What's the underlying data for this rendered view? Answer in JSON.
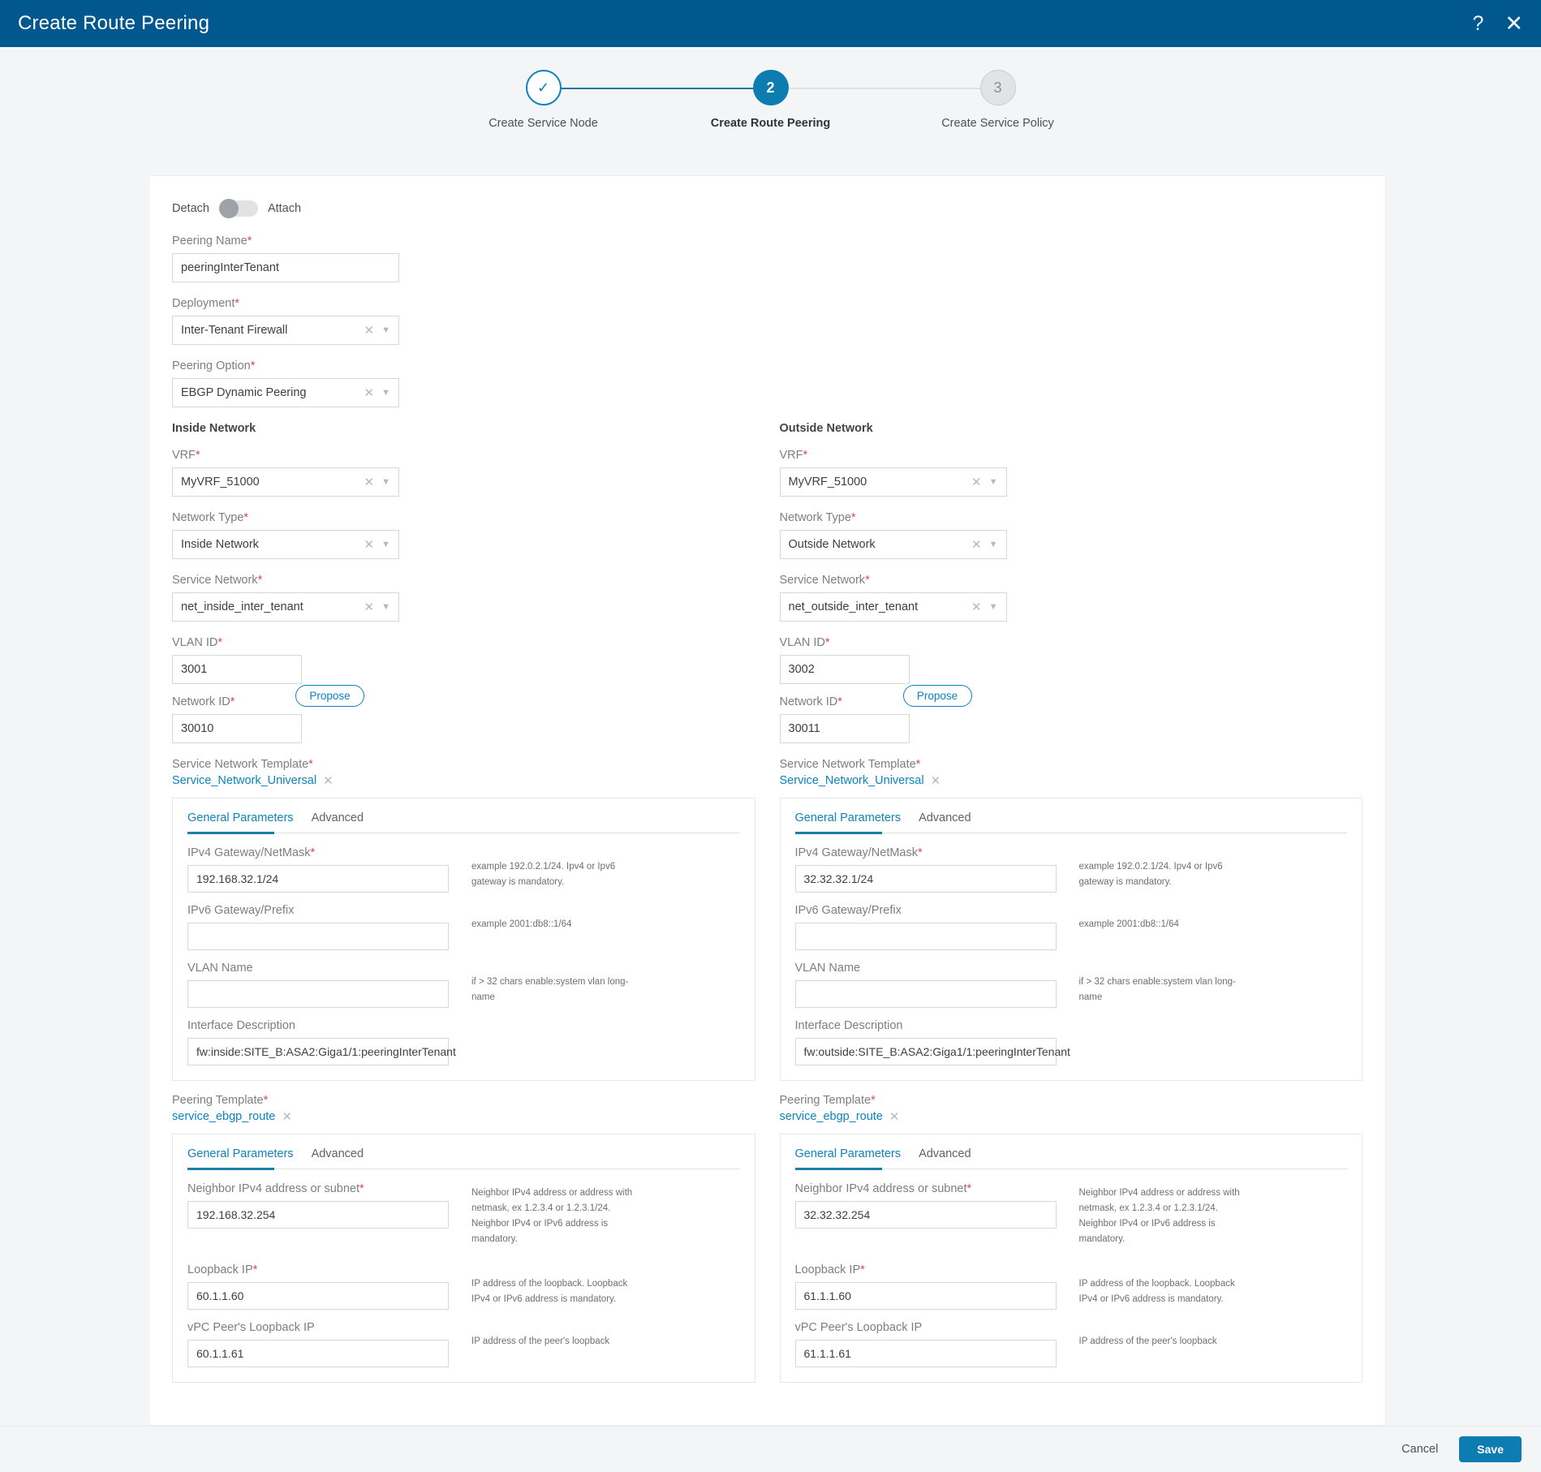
{
  "header": {
    "title": "Create Route Peering",
    "help_icon": "question-mark-icon",
    "close_icon": "close-icon"
  },
  "stepper": {
    "steps": [
      {
        "number": "1",
        "glyph": "✓",
        "label": "Create Service Node",
        "state": "done"
      },
      {
        "number": "2",
        "glyph": "2",
        "label": "Create Route Peering",
        "state": "active"
      },
      {
        "number": "3",
        "glyph": "3",
        "label": "Create Service Policy",
        "state": "todo"
      }
    ]
  },
  "toggle": {
    "left_label": "Detach",
    "right_label": "Attach",
    "state": "detach"
  },
  "form": {
    "peering_name": {
      "label": "Peering Name",
      "required": true,
      "value": "peeringInterTenant"
    },
    "deployment": {
      "label": "Deployment",
      "required": true,
      "value": "Inter-Tenant Firewall"
    },
    "peering_option": {
      "label": "Peering Option",
      "required": true,
      "value": "EBGP Dynamic Peering"
    }
  },
  "inside": {
    "heading": "Inside Network",
    "vrf": {
      "label": "VRF",
      "value": "MyVRF_51000"
    },
    "network_type": {
      "label": "Network Type",
      "value": "Inside Network"
    },
    "service_network": {
      "label": "Service Network",
      "value": "net_inside_inter_tenant"
    },
    "vlan_id": {
      "label": "VLAN ID",
      "value": "3001"
    },
    "network_id": {
      "label": "Network ID",
      "value": "30010"
    },
    "propose_label": "Propose",
    "service_network_template": {
      "label": "Service Network Template",
      "value": "Service_Network_Universal"
    },
    "net_tabs": {
      "general": "General Parameters",
      "advanced": "Advanced"
    },
    "net_params": {
      "ipv4_gateway": {
        "label": "IPv4 Gateway/NetMask",
        "required": true,
        "value": "192.168.32.1/24",
        "help": "example 192.0.2.1/24. Ipv4 or Ipv6 gateway is mandatory."
      },
      "ipv6_gateway": {
        "label": "IPv6 Gateway/Prefix",
        "required": false,
        "value": "",
        "help": "example 2001:db8::1/64"
      },
      "vlan_name": {
        "label": "VLAN Name",
        "required": false,
        "value": "",
        "help": "if > 32 chars enable:system vlan long-name"
      },
      "interface_description": {
        "label": "Interface Description",
        "required": false,
        "value": "fw:inside:SITE_B:ASA2:Giga1/1:peeringInterTenant",
        "help": ""
      }
    },
    "peering_template": {
      "label": "Peering Template",
      "value": "service_ebgp_route"
    },
    "peer_tabs": {
      "general": "General Parameters",
      "advanced": "Advanced"
    },
    "peer_params": {
      "neighbor_ipv4": {
        "label": "Neighbor IPv4 address or subnet",
        "required": true,
        "value": "192.168.32.254",
        "help": "Neighbor IPv4 address or address with netmask, ex 1.2.3.4 or 1.2.3.1/24. Neighbor IPv4 or IPv6 address is mandatory."
      },
      "loopback_ip": {
        "label": "Loopback IP",
        "required": true,
        "value": "60.1.1.60",
        "help": "IP address of the loopback. Loopback IPv4 or IPv6 address is mandatory."
      },
      "vpc_peer_loopback_ip": {
        "label": "vPC Peer's Loopback IP",
        "required": false,
        "value": "60.1.1.61",
        "help": "IP address of the peer's loopback"
      }
    }
  },
  "outside": {
    "heading": "Outside Network",
    "vrf": {
      "label": "VRF",
      "value": "MyVRF_51000"
    },
    "network_type": {
      "label": "Network Type",
      "value": "Outside Network"
    },
    "service_network": {
      "label": "Service Network",
      "value": "net_outside_inter_tenant"
    },
    "vlan_id": {
      "label": "VLAN ID",
      "value": "3002"
    },
    "network_id": {
      "label": "Network ID",
      "value": "30011"
    },
    "propose_label": "Propose",
    "service_network_template": {
      "label": "Service Network Template",
      "value": "Service_Network_Universal"
    },
    "net_tabs": {
      "general": "General Parameters",
      "advanced": "Advanced"
    },
    "net_params": {
      "ipv4_gateway": {
        "label": "IPv4 Gateway/NetMask",
        "required": true,
        "value": "32.32.32.1/24",
        "help": "example 192.0.2.1/24. Ipv4 or Ipv6 gateway is mandatory."
      },
      "ipv6_gateway": {
        "label": "IPv6 Gateway/Prefix",
        "required": false,
        "value": "",
        "help": "example 2001:db8::1/64"
      },
      "vlan_name": {
        "label": "VLAN Name",
        "required": false,
        "value": "",
        "help": "if > 32 chars enable:system vlan long-name"
      },
      "interface_description": {
        "label": "Interface Description",
        "required": false,
        "value": "fw:outside:SITE_B:ASA2:Giga1/1:peeringInterTenant",
        "help": ""
      }
    },
    "peering_template": {
      "label": "Peering Template",
      "value": "service_ebgp_route"
    },
    "peer_tabs": {
      "general": "General Parameters",
      "advanced": "Advanced"
    },
    "peer_params": {
      "neighbor_ipv4": {
        "label": "Neighbor IPv4 address or subnet",
        "required": true,
        "value": "32.32.32.254",
        "help": "Neighbor IPv4 address or address with netmask, ex 1.2.3.4 or 1.2.3.1/24. Neighbor IPv4 or IPv6 address is mandatory."
      },
      "loopback_ip": {
        "label": "Loopback IP",
        "required": true,
        "value": "61.1.1.60",
        "help": "IP address of the loopback. Loopback IPv4 or IPv6 address is mandatory."
      },
      "vpc_peer_loopback_ip": {
        "label": "vPC Peer's Loopback IP",
        "required": false,
        "value": "61.1.1.61",
        "help": "IP address of the peer's loopback"
      }
    }
  },
  "footer": {
    "cancel_label": "Cancel",
    "save_label": "Save"
  },
  "colors": {
    "header_bg": "#00588f",
    "accent": "#0d82bd",
    "primary_button": "#0d7cb0",
    "required_star": "#e2435f"
  }
}
